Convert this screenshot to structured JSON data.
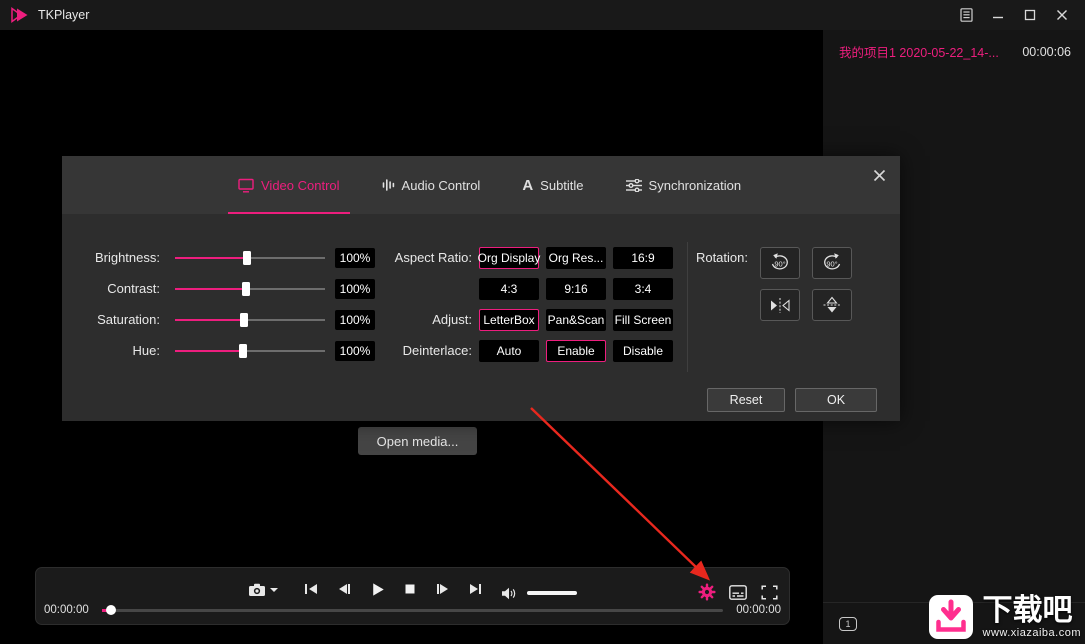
{
  "accent": "#ed1e7e",
  "titlebar": {
    "app_name": "TKPlayer"
  },
  "playlist": {
    "items": [
      {
        "name": "我的项目1 2020-05-22_14-...",
        "duration": "00:00:06"
      }
    ],
    "count_badge": "1"
  },
  "dialog": {
    "tabs": [
      {
        "label": "Video Control",
        "active": true
      },
      {
        "label": "Audio Control",
        "active": false
      },
      {
        "label": "Subtitle",
        "active": false,
        "icon_glyph": "A"
      },
      {
        "label": "Synchronization",
        "active": false
      }
    ],
    "sliders": [
      {
        "label": "Brightness:",
        "value": "100%",
        "percent": 48
      },
      {
        "label": "Contrast:",
        "value": "100%",
        "percent": 47
      },
      {
        "label": "Saturation:",
        "value": "100%",
        "percent": 46
      },
      {
        "label": "Hue:",
        "value": "100%",
        "percent": 45
      }
    ],
    "aspect_ratio": {
      "label": "Aspect Ratio:",
      "row1": [
        {
          "label": "Org Display",
          "active": true
        },
        {
          "label": "Org Res...",
          "active": false
        },
        {
          "label": "16:9",
          "active": false
        }
      ],
      "row2": [
        {
          "label": "4:3",
          "active": false
        },
        {
          "label": "9:16",
          "active": false
        },
        {
          "label": "3:4",
          "active": false
        }
      ]
    },
    "adjust": {
      "label": "Adjust:",
      "buttons": [
        {
          "label": "LetterBox",
          "active": true
        },
        {
          "label": "Pan&Scan",
          "active": false
        },
        {
          "label": "Fill Screen",
          "active": false
        }
      ]
    },
    "deinterlace": {
      "label": "Deinterlace:",
      "buttons": [
        {
          "label": "Auto",
          "active": false
        },
        {
          "label": "Enable",
          "active": true
        },
        {
          "label": "Disable",
          "active": false
        }
      ]
    },
    "rotation": {
      "label": "Rotation:",
      "degree_label": "90°"
    },
    "reset_label": "Reset",
    "ok_label": "OK"
  },
  "open_media_label": "Open media...",
  "control_bar": {
    "elapsed_time": "00:00:00",
    "total_time": "00:00:00"
  },
  "watermark": {
    "title": "下载吧",
    "url": "www.xiazaiba.com"
  }
}
